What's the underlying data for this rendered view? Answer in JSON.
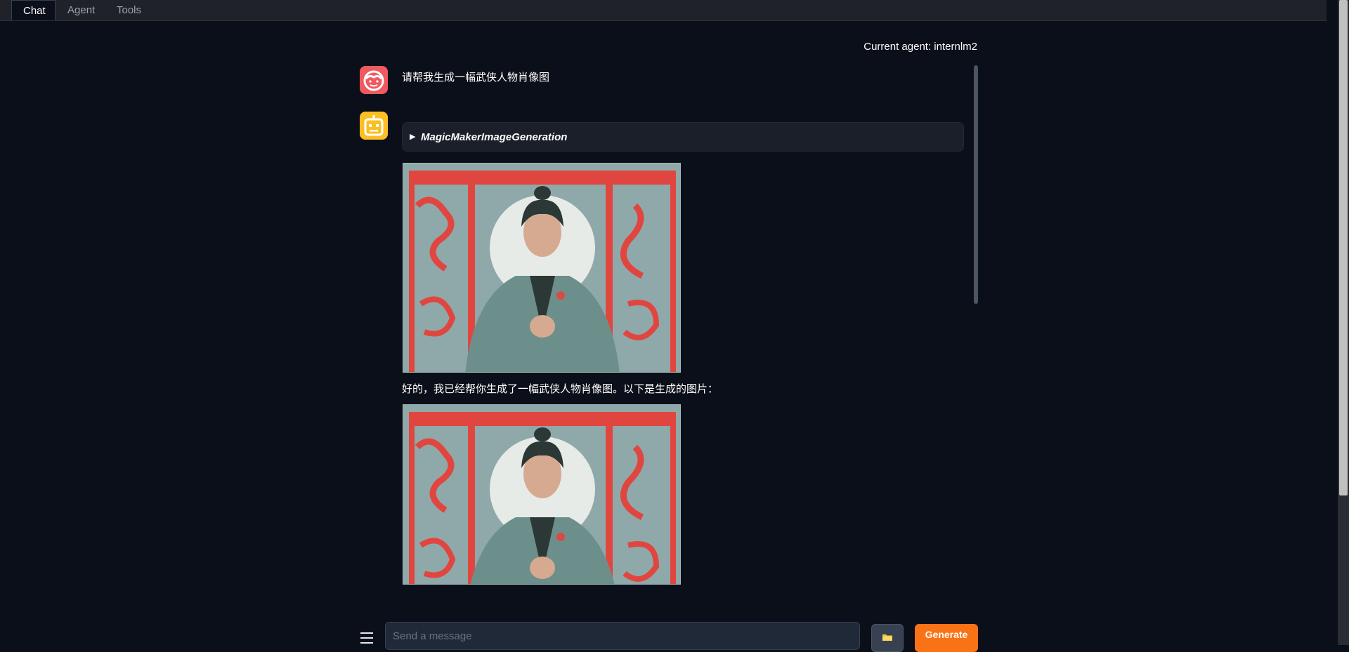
{
  "tabs": [
    {
      "label": "Chat",
      "active": true
    },
    {
      "label": "Agent",
      "active": false
    },
    {
      "label": "Tools",
      "active": false
    }
  ],
  "header": {
    "current_agent": "Current agent: internlm2"
  },
  "messages": [
    {
      "role": "user",
      "avatar_icon": "user-avatar-icon",
      "text": "请帮我生成一幅武侠人物肖像图"
    },
    {
      "role": "assistant",
      "avatar_icon": "robot-avatar-icon",
      "tool_call": {
        "name": "MagicMakerImageGeneration",
        "expanded": false
      },
      "text": "好的，我已经帮你生成了一幅武侠人物肖像图。以下是生成的图片："
    }
  ],
  "input": {
    "placeholder": "Send a message",
    "value": ""
  },
  "buttons": {
    "generate_label": "Generate",
    "folder_icon": "folder-icon",
    "menu_icon": "menu-icon"
  },
  "colors": {
    "background": "#0b0f19",
    "accent": "#f97316",
    "user_avatar": "#f0595f",
    "bot_avatar": "#fbbf24"
  }
}
